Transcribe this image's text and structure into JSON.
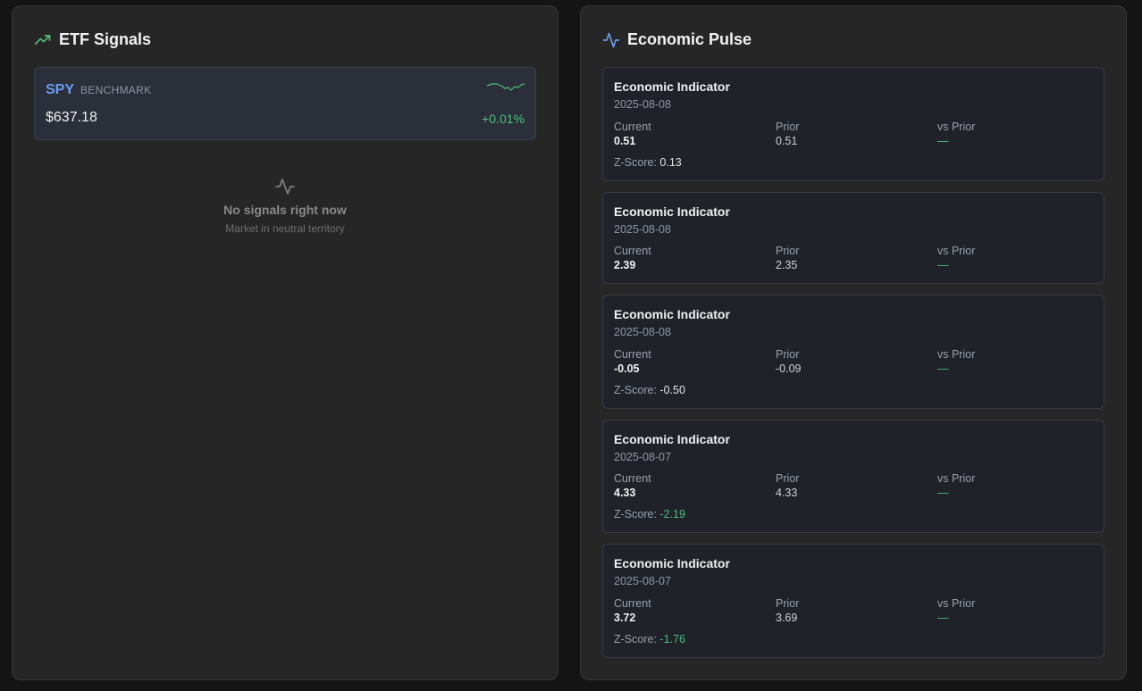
{
  "etf": {
    "title": "ETF Signals",
    "icon": "trending-up-icon",
    "benchmark": {
      "ticker": "SPY",
      "tag": "BENCHMARK",
      "price": "$637.18",
      "change": "+0.01%"
    },
    "empty": {
      "title": "No signals right now",
      "subtitle": "Market in neutral territory"
    }
  },
  "econ": {
    "title": "Economic Pulse",
    "icon": "activity-icon",
    "labels": {
      "current": "Current",
      "prior": "Prior",
      "vs_prior": "vs Prior",
      "zscore": "Z-Score:"
    },
    "indicators": [
      {
        "name": "Economic Indicator",
        "date": "2025-08-08",
        "current": "0.51",
        "prior": "0.51",
        "vs_prior": "—",
        "zscore": "0.13"
      },
      {
        "name": "Economic Indicator",
        "date": "2025-08-08",
        "current": "2.39",
        "prior": "2.35",
        "vs_prior": "—",
        "zscore": ""
      },
      {
        "name": "Economic Indicator",
        "date": "2025-08-08",
        "current": "-0.05",
        "prior": "-0.09",
        "vs_prior": "—",
        "zscore": "-0.50"
      },
      {
        "name": "Economic Indicator",
        "date": "2025-08-07",
        "current": "4.33",
        "prior": "4.33",
        "vs_prior": "—",
        "zscore": "-2.19"
      },
      {
        "name": "Economic Indicator",
        "date": "2025-08-07",
        "current": "3.72",
        "prior": "3.69",
        "vs_prior": "—",
        "zscore": "-1.76"
      }
    ]
  },
  "colors": {
    "accent_blue": "#6b9cf0",
    "positive_green": "#4fbf7b",
    "panel_bg": "#262626",
    "page_bg": "#141414"
  }
}
